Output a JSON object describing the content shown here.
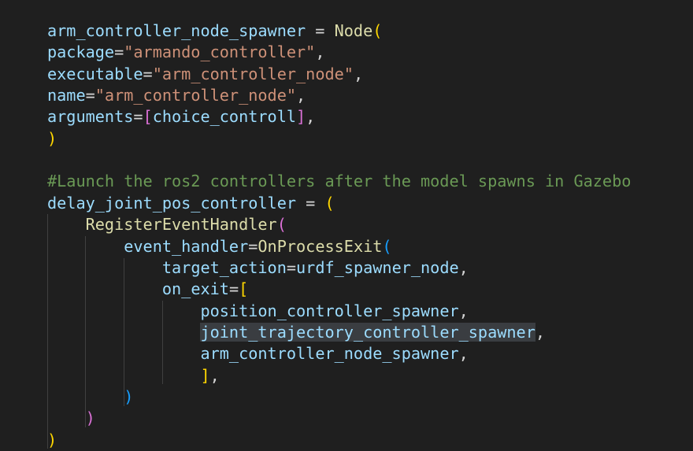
{
  "editor": {
    "lines": [
      [
        {
          "t": "arm_controller_node_spawner",
          "c": "var"
        },
        {
          "t": " = ",
          "c": "op"
        },
        {
          "t": "Node",
          "c": "fn"
        },
        {
          "t": "(",
          "c": "b1"
        }
      ],
      [
        {
          "t": "package",
          "c": "var"
        },
        {
          "t": "=",
          "c": "op"
        },
        {
          "t": "\"armando_controller\"",
          "c": "str"
        },
        {
          "t": ",",
          "c": "op"
        }
      ],
      [
        {
          "t": "executable",
          "c": "var"
        },
        {
          "t": "=",
          "c": "op"
        },
        {
          "t": "\"arm_controller_node\"",
          "c": "str"
        },
        {
          "t": ",",
          "c": "op"
        }
      ],
      [
        {
          "t": "name",
          "c": "var"
        },
        {
          "t": "=",
          "c": "op"
        },
        {
          "t": "\"arm_controller_node\"",
          "c": "str"
        },
        {
          "t": ",",
          "c": "op"
        }
      ],
      [
        {
          "t": "arguments",
          "c": "var"
        },
        {
          "t": "=",
          "c": "op"
        },
        {
          "t": "[",
          "c": "b2"
        },
        {
          "t": "choice_controll",
          "c": "var"
        },
        {
          "t": "]",
          "c": "b2"
        },
        {
          "t": ",",
          "c": "op"
        }
      ],
      [
        {
          "t": ")",
          "c": "b1"
        }
      ],
      [],
      [
        {
          "t": "#Launch the ros2 controllers after the model spawns in Gazebo",
          "c": "cmt"
        }
      ],
      [
        {
          "t": "delay_joint_pos_controller",
          "c": "var"
        },
        {
          "t": " = ",
          "c": "op"
        },
        {
          "t": "(",
          "c": "b1"
        }
      ],
      [
        {
          "t": "    ",
          "c": "op"
        },
        {
          "t": "RegisterEventHandler",
          "c": "fn"
        },
        {
          "t": "(",
          "c": "b2"
        }
      ],
      [
        {
          "t": "        ",
          "c": "op"
        },
        {
          "t": "event_handler",
          "c": "var"
        },
        {
          "t": "=",
          "c": "op"
        },
        {
          "t": "OnProcessExit",
          "c": "fn"
        },
        {
          "t": "(",
          "c": "b3"
        }
      ],
      [
        {
          "t": "            ",
          "c": "op"
        },
        {
          "t": "target_action",
          "c": "var"
        },
        {
          "t": "=",
          "c": "op"
        },
        {
          "t": "urdf_spawner_node",
          "c": "var"
        },
        {
          "t": ",",
          "c": "op"
        }
      ],
      [
        {
          "t": "            ",
          "c": "op"
        },
        {
          "t": "on_exit",
          "c": "var"
        },
        {
          "t": "=",
          "c": "op"
        },
        {
          "t": "[",
          "c": "b1"
        }
      ],
      [
        {
          "t": "                ",
          "c": "op"
        },
        {
          "t": "position_controller_spawner",
          "c": "var"
        },
        {
          "t": ",",
          "c": "op"
        }
      ],
      [
        {
          "t": "                ",
          "c": "op"
        },
        {
          "t": "joint_trajectory_controller_spawner",
          "c": "var",
          "sel": true
        },
        {
          "t": ",",
          "c": "op"
        }
      ],
      [
        {
          "t": "                ",
          "c": "op"
        },
        {
          "t": "arm_controller_node_spawner",
          "c": "var"
        },
        {
          "t": ",",
          "c": "op"
        }
      ],
      [
        {
          "t": "                ",
          "c": "op"
        },
        {
          "t": "]",
          "c": "b1"
        },
        {
          "t": ",",
          "c": "op"
        }
      ],
      [
        {
          "t": "        ",
          "c": "op"
        },
        {
          "t": ")",
          "c": "b3"
        }
      ],
      [
        {
          "t": "    ",
          "c": "op"
        },
        {
          "t": ")",
          "c": "b2"
        }
      ],
      [
        {
          "t": ")",
          "c": "b1"
        }
      ]
    ]
  },
  "colors": {
    "background": "#1f1f1f",
    "variable": "#9cdcfe",
    "function": "#dcdcaa",
    "string": "#ce9178",
    "comment": "#6a9955",
    "bracket_gold": "#ffd700",
    "bracket_orchid": "#da70d6",
    "bracket_blue": "#179fff",
    "selection": "#3a3d41"
  }
}
